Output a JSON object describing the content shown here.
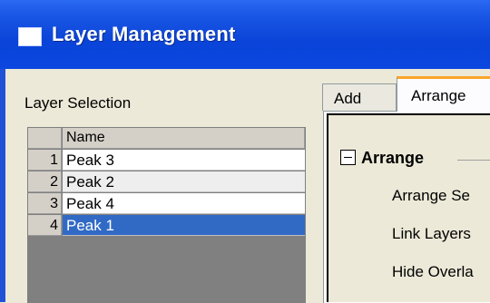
{
  "window": {
    "title": "Layer Management"
  },
  "layer_selection": {
    "label": "Layer Selection",
    "column_header": "Name",
    "rows": [
      {
        "num": "1",
        "name": "Peak 3"
      },
      {
        "num": "2",
        "name": "Peak 2"
      },
      {
        "num": "3",
        "name": "Peak 4"
      },
      {
        "num": "4",
        "name": "Peak 1"
      }
    ],
    "selected_row": "4"
  },
  "tabs": [
    {
      "label": "Add"
    },
    {
      "label": "Arrange"
    }
  ],
  "arrange_panel": {
    "heading": "Arrange",
    "options": [
      "Arrange Se",
      "Link Layers",
      "Hide Overla"
    ]
  },
  "colors": {
    "titlebar": "#0a44d8",
    "selection": "#316ac5",
    "active_tab_accent": "#f9a62b"
  }
}
